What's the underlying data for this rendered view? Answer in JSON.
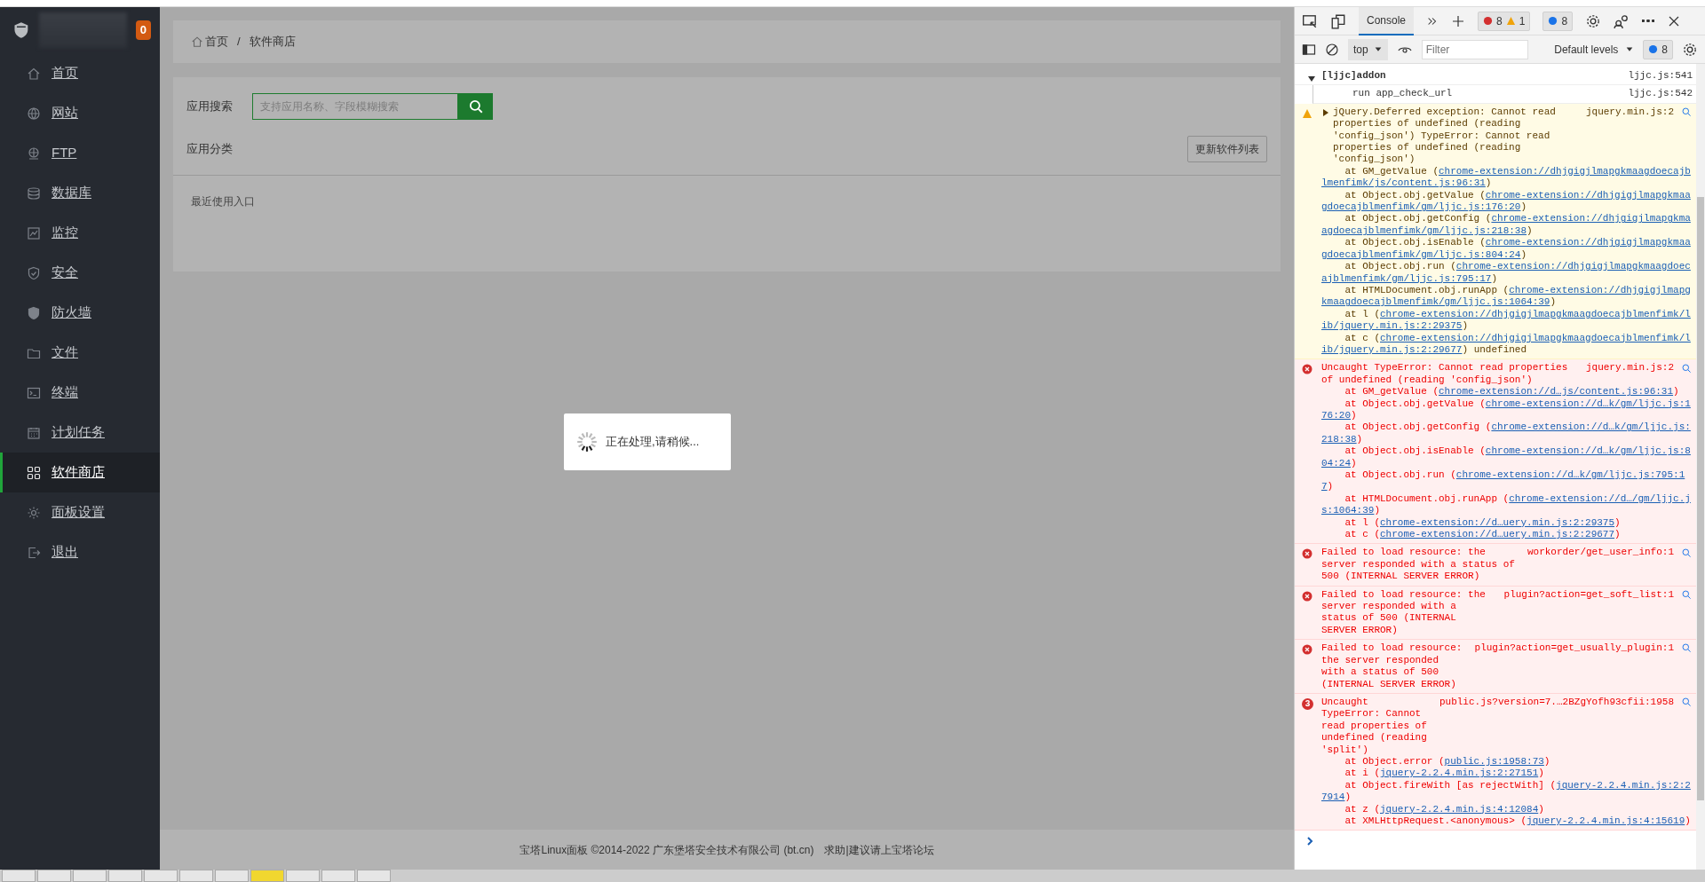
{
  "sidebar": {
    "badge": "0",
    "items": [
      {
        "label": "首页",
        "selected": false
      },
      {
        "label": "网站",
        "selected": false
      },
      {
        "label": "FTP",
        "selected": false
      },
      {
        "label": "数据库",
        "selected": false
      },
      {
        "label": "监控",
        "selected": false
      },
      {
        "label": "安全",
        "selected": false
      },
      {
        "label": "防火墙",
        "selected": false
      },
      {
        "label": "文件",
        "selected": false
      },
      {
        "label": "终端",
        "selected": false
      },
      {
        "label": "计划任务",
        "selected": false
      },
      {
        "label": "软件商店",
        "selected": true
      },
      {
        "label": "面板设置",
        "selected": false
      },
      {
        "label": "退出",
        "selected": false
      }
    ]
  },
  "breadcrumb": {
    "items": [
      "首页",
      "软件商店"
    ],
    "separator": "/"
  },
  "search": {
    "label": "应用搜索",
    "placeholder": "支持应用名称、字段模糊搜索"
  },
  "category": {
    "label": "应用分类",
    "refresh_button": "更新软件列表"
  },
  "recent": {
    "label": "最近使用入口"
  },
  "loading": {
    "message": "正在处理,请稍候..."
  },
  "footer": {
    "copyright": "宝塔Linux面板 ©2014-2022 广东堡塔安全技术有限公司 (bt.cn)",
    "link": "求助|建议请上宝塔论坛"
  },
  "devtools": {
    "tabs": [
      {
        "label": "Console",
        "selected": true
      }
    ],
    "errors": "8",
    "warnings": "1",
    "info": "8",
    "context": "top",
    "filter_placeholder": "Filter",
    "levels": "Default levels",
    "issues": "8",
    "entries": [
      {
        "kind": "group",
        "expanded": true,
        "message": "[ljjc]addon",
        "source": "ljjc.js:541",
        "children": [
          {
            "kind": "log",
            "message": "run app_check_url",
            "source": "ljjc.js:542"
          }
        ]
      },
      {
        "kind": "warning",
        "expanded": false,
        "message": "jQuery.Deferred exception: Cannot read properties of undefined (reading 'config_json') TypeError: Cannot read properties of undefined (reading 'config_json')",
        "source": "jquery.min.js:2",
        "stack": [
          {
            "prefix": "at GM_getValue (",
            "link": "chrome-extension://dhjgigjlmapgkmaagdoecajblmenfimk/js/content.js:96:31",
            "suffix": ")"
          },
          {
            "prefix": "at Object.obj.getValue (",
            "link": "chrome-extension://dhjgigjlmapgkmaagdoecajblmenfimk/gm/ljjc.js:176:20",
            "suffix": ")"
          },
          {
            "prefix": "at Object.obj.getConfig (",
            "link": "chrome-extension://dhjgigjlmapgkmaagdoecajblmenfimk/gm/ljjc.js:218:38",
            "suffix": ")"
          },
          {
            "prefix": "at Object.obj.isEnable (",
            "link": "chrome-extension://dhjgigjlmapgkmaagdoecajblmenfimk/gm/ljjc.js:804:24",
            "suffix": ")"
          },
          {
            "prefix": "at Object.obj.run (",
            "link": "chrome-extension://dhjgigjlmapgkmaagdoecajblmenfimk/gm/ljjc.js:795:17",
            "suffix": ")"
          },
          {
            "prefix": "at HTMLDocument.obj.runApp (",
            "link": "chrome-extension://dhjgigjlmapgkmaagdoecajblmenfimk/gm/ljjc.js:1064:39",
            "suffix": ")"
          },
          {
            "prefix": "at l (",
            "link": "chrome-extension://dhjgigjlmapgkmaagdoecajblmenfimk/lib/jquery.min.js:2:29375",
            "suffix": ")"
          },
          {
            "prefix": "at c (",
            "link": "chrome-extension://dhjgigjlmapgkmaagdoecajblmenfimk/lib/jquery.min.js:2:29677",
            "suffix": ") undefined"
          }
        ]
      },
      {
        "kind": "error",
        "message": "Uncaught TypeError: Cannot read properties of undefined (reading 'config_json')",
        "source": "jquery.min.js:2",
        "stack": [
          {
            "prefix": "at GM_getValue (",
            "link": "chrome-extension://d…js/content.js:96:31",
            "suffix": ")"
          },
          {
            "prefix": "at Object.obj.getValue (",
            "link": "chrome-extension://d…k/gm/ljjc.js:176:20",
            "suffix": ")"
          },
          {
            "prefix": "at Object.obj.getConfig (",
            "link": "chrome-extension://d…k/gm/ljjc.js:218:38",
            "suffix": ")"
          },
          {
            "prefix": "at Object.obj.isEnable (",
            "link": "chrome-extension://d…k/gm/ljjc.js:804:24",
            "suffix": ")"
          },
          {
            "prefix": "at Object.obj.run (",
            "link": "chrome-extension://d…k/gm/ljjc.js:795:17",
            "suffix": ")"
          },
          {
            "prefix": "at HTMLDocument.obj.runApp (",
            "link": "chrome-extension://d…/gm/ljjc.js:1064:39",
            "suffix": ")"
          },
          {
            "prefix": "at l (",
            "link": "chrome-extension://d…uery.min.js:2:29375",
            "suffix": ")"
          },
          {
            "prefix": "at c (",
            "link": "chrome-extension://d…uery.min.js:2:29677",
            "suffix": ")"
          }
        ]
      },
      {
        "kind": "error",
        "message": "Failed to load resource: the server responded with a status of 500 (INTERNAL SERVER ERROR)",
        "source": "workorder/get_user_info:1"
      },
      {
        "kind": "error",
        "message": "Failed to load resource: the server responded with a status of 500 (INTERNAL SERVER ERROR)",
        "source": "plugin?action=get_soft_list:1"
      },
      {
        "kind": "error",
        "message": "Failed to load resource: the server responded with a status of 500 (INTERNAL SERVER ERROR)",
        "source": "plugin?action=get_usually_plugin:1"
      },
      {
        "kind": "error",
        "repeat": "3",
        "message": "Uncaught TypeError: Cannot read properties of undefined (reading 'split')",
        "source": "public.js?version=7.…2BZgYofh93cfii:1958",
        "stack": [
          {
            "prefix": "at Object.error (",
            "link": "public.js:1958:73",
            "suffix": ")"
          },
          {
            "prefix": "at i (",
            "link": "jquery-2.2.4.min.js:2:27151",
            "suffix": ")"
          },
          {
            "prefix": "at Object.fireWith [as rejectWith] (",
            "link": "jquery-2.2.4.min.js:2:27914",
            "suffix": ")"
          },
          {
            "prefix": "at z (",
            "link": "jquery-2.2.4.min.js:4:12084",
            "suffix": ")"
          },
          {
            "prefix": "at XMLHttpRequest.<anonymous> (",
            "link": "jquery-2.2.4.min.js:4:15619",
            "suffix": ")"
          }
        ]
      }
    ]
  },
  "bottom_tabs": [
    {
      "selected": false
    },
    {
      "selected": false
    },
    {
      "selected": false
    },
    {
      "selected": false
    },
    {
      "selected": false
    },
    {
      "selected": false
    },
    {
      "selected": false
    },
    {
      "selected": true
    },
    {
      "selected": false
    },
    {
      "selected": false
    },
    {
      "selected": false
    }
  ]
}
